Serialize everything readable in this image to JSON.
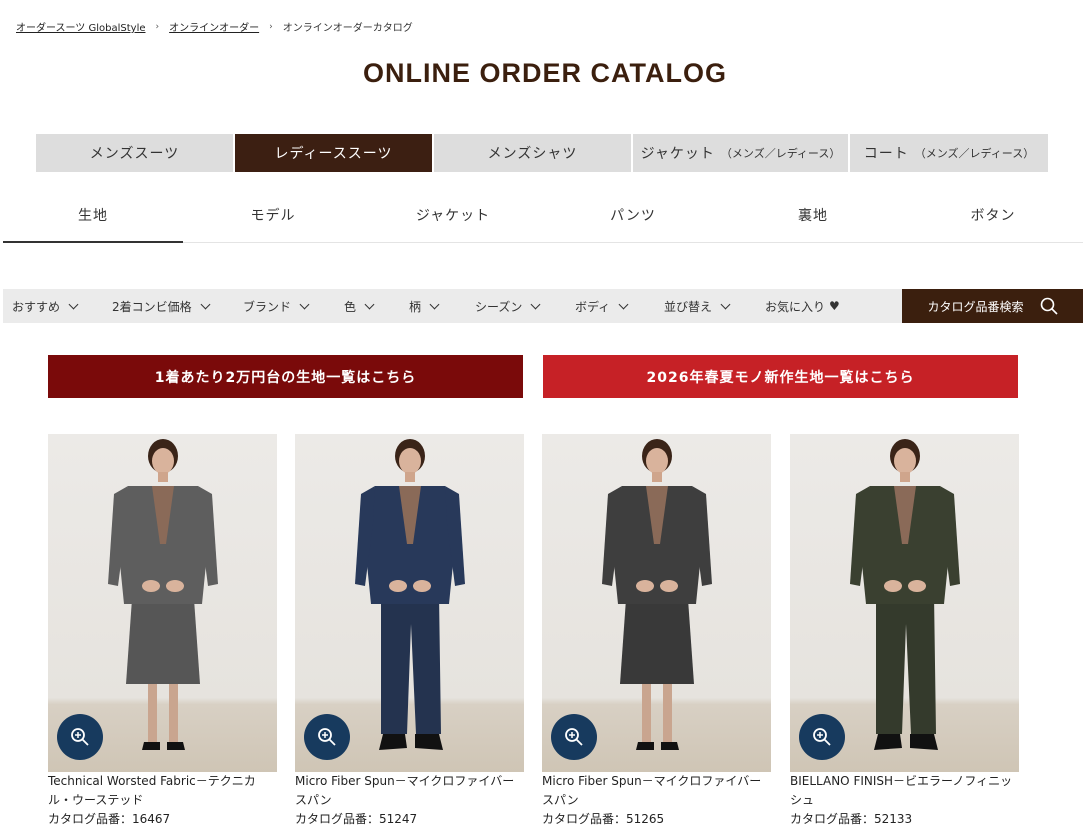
{
  "breadcrumb": [
    "オーダースーツ GlobalStyle",
    "オンラインオーダー",
    "オンラインオーダーカタログ"
  ],
  "title": "ONLINE ORDER CATALOG",
  "category_tabs": [
    {
      "label": "メンズスーツ",
      "sub": ""
    },
    {
      "label": "レディーススーツ",
      "sub": ""
    },
    {
      "label": "メンズシャツ",
      "sub": ""
    },
    {
      "label": "ジャケット",
      "sub": "（メンズ／レディース）"
    },
    {
      "label": "コート",
      "sub": "（メンズ／レディース）"
    }
  ],
  "sub_tabs": [
    "生地",
    "モデル",
    "ジャケット",
    "パンツ",
    "裏地",
    "ボタン"
  ],
  "filters": [
    "おすすめ",
    "2着コンビ価格",
    "ブランド",
    "色",
    "柄",
    "シーズン",
    "ボディ",
    "並び替え",
    "お気に入り"
  ],
  "search_label": "カタログ品番検索",
  "banners": [
    "1着あたり2万円台の生地一覧はこちら",
    "2026年春夏モノ新作生地一覧はこちら"
  ],
  "products": [
    {
      "name": "Technical Worsted Fabric－テクニカル・ウーステッド",
      "code": "カタログ品番：16467",
      "jacket": "#5e5e5e",
      "bottom": "#565656",
      "type": "skirt"
    },
    {
      "name": "Micro Fiber Spun－マイクロファイバースパン",
      "code": "カタログ品番：51247",
      "jacket": "#28395a",
      "bottom": "#24334f",
      "type": "pants"
    },
    {
      "name": "Micro Fiber Spun－マイクロファイバースパン",
      "code": "カタログ品番：51265",
      "jacket": "#3e3e3e",
      "bottom": "#393939",
      "type": "skirt"
    },
    {
      "name": "BIELLANO FINISH－ビエラーノフィニッシュ",
      "code": "カタログ品番：52133",
      "jacket": "#3a4030",
      "bottom": "#343a2c",
      "type": "pants"
    }
  ],
  "colors": {
    "brown": "#3b1f0e",
    "banner_dark": "#7a0a0a",
    "banner_red": "#c62126",
    "zoom": "#173a5e"
  },
  "icons": {
    "search": "search-icon",
    "zoom": "zoom-in-icon",
    "heart": "heart-icon"
  }
}
